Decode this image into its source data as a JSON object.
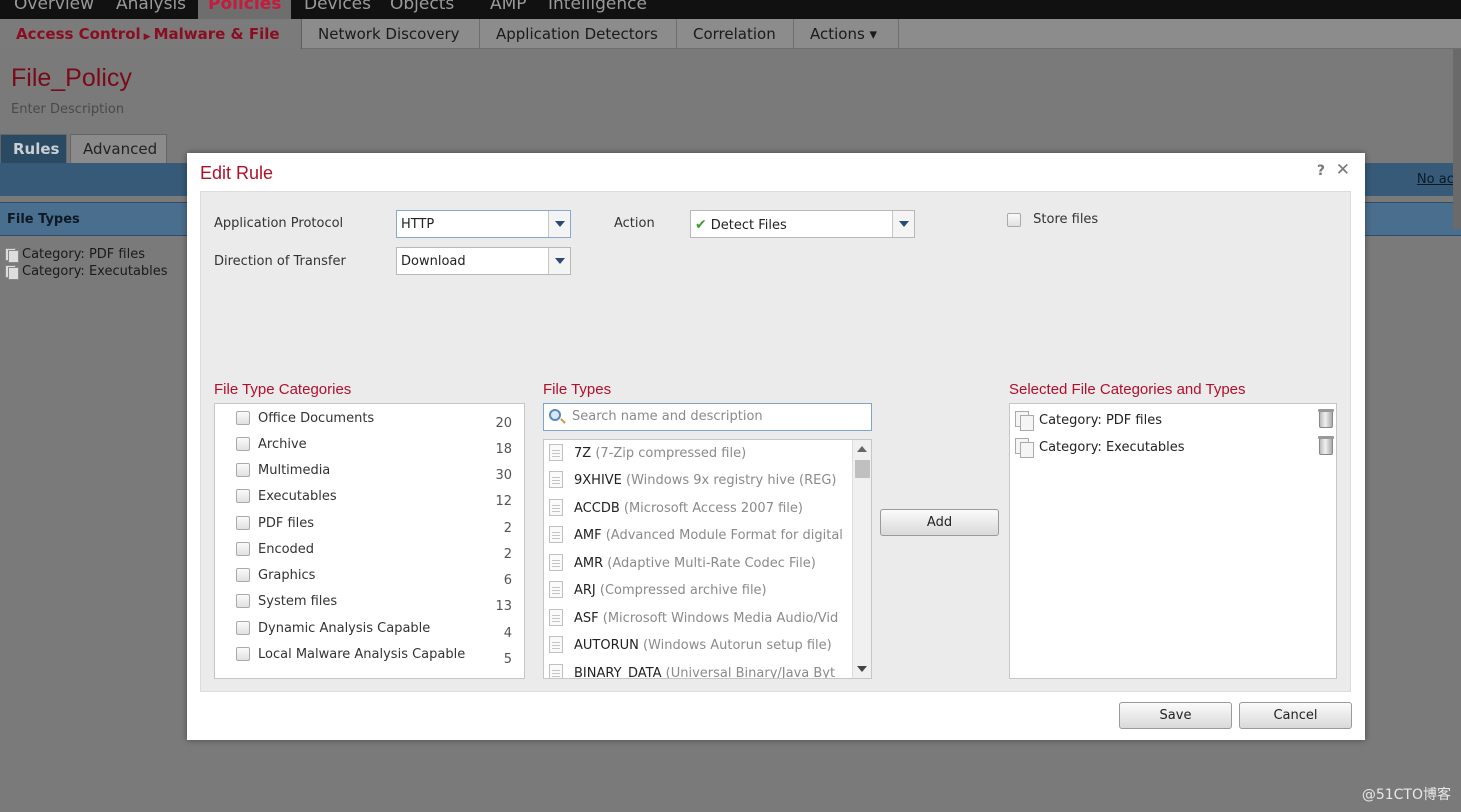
{
  "topnav": {
    "items": [
      "Overview",
      "Analysis",
      "Policies",
      "Devices",
      "Objects",
      "AMP",
      "Intelligence"
    ]
  },
  "subnav": {
    "active_parent": "Access Control",
    "active_child": "Malware & File",
    "tabs": [
      "Network Discovery",
      "Application Detectors",
      "Correlation",
      "Actions ▾"
    ]
  },
  "page": {
    "title": "File_Policy",
    "description": "Enter Description",
    "tabs": [
      "Rules",
      "Advanced"
    ],
    "no_access_link": "No acc",
    "file_types_header": "File Types",
    "rule_items": [
      "Category: PDF files",
      "Category: Executables"
    ]
  },
  "modal": {
    "title": "Edit Rule",
    "help": "?",
    "close": "✕",
    "application_protocol": {
      "label": "Application Protocol",
      "value": "HTTP"
    },
    "direction": {
      "label": "Direction of Transfer",
      "value": "Download"
    },
    "action": {
      "label": "Action",
      "value": "Detect Files"
    },
    "store_files": {
      "label": "Store files",
      "checked": false
    },
    "categories": {
      "title": "File Type Categories",
      "items": [
        {
          "name": "Office Documents",
          "count": "20"
        },
        {
          "name": "Archive",
          "count": "18"
        },
        {
          "name": "Multimedia",
          "count": "30"
        },
        {
          "name": "Executables",
          "count": "12"
        },
        {
          "name": "PDF files",
          "count": "2"
        },
        {
          "name": "Encoded",
          "count": "2"
        },
        {
          "name": "Graphics",
          "count": "6"
        },
        {
          "name": "System files",
          "count": "13"
        },
        {
          "name": "Dynamic Analysis Capable",
          "count": "4"
        },
        {
          "name": "Local Malware Analysis Capable",
          "count": "5"
        }
      ]
    },
    "file_types": {
      "title": "File Types",
      "search_placeholder": "Search name and description",
      "items": [
        {
          "code": "7Z",
          "desc": "(7-Zip compressed file)"
        },
        {
          "code": "9XHIVE",
          "desc": "(Windows 9x registry hive (REG)"
        },
        {
          "code": "ACCDB",
          "desc": "(Microsoft Access 2007 file)"
        },
        {
          "code": "AMF",
          "desc": "(Advanced Module Format for digital"
        },
        {
          "code": "AMR",
          "desc": "(Adaptive Multi-Rate Codec File)"
        },
        {
          "code": "ARJ",
          "desc": "(Compressed archive file)"
        },
        {
          "code": "ASF",
          "desc": "(Microsoft Windows Media Audio/Vid"
        },
        {
          "code": "AUTORUN",
          "desc": "(Windows Autorun setup file)"
        },
        {
          "code": "BINARY_DATA",
          "desc": "(Universal Binary/Java Byt"
        }
      ]
    },
    "add_label": "Add",
    "selected": {
      "title": "Selected File Categories and Types",
      "items": [
        "Category: PDF files",
        "Category: Executables"
      ]
    },
    "save_label": "Save",
    "cancel_label": "Cancel"
  },
  "watermark": "@51CTO博客",
  "colors": {
    "accent_red": "#b0102c",
    "nav_blue": "#365a78",
    "check_green": "#3aa03a"
  }
}
